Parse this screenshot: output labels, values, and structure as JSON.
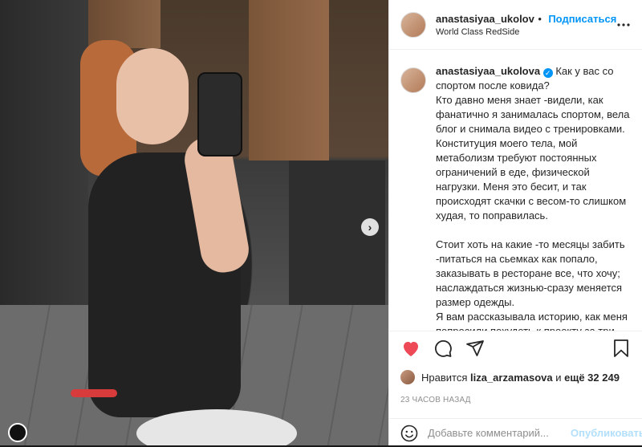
{
  "header": {
    "username": "anastasiyaa_ukolov",
    "follow_label": "Подписаться",
    "separator": "•",
    "location": "World Class RedSide",
    "more_icon": "more-horizontal-icon"
  },
  "caption": {
    "username": "anastasiyaa_ukolova",
    "text": "Как у вас со спортом после ковида?\nКто давно меня знает -видели, как фанатично я занималась спортом, вела блог и снимала видео с тренировками. Конституция моего тела, мой метаболизм требуют постоянных ограничений в еде, физической нагрузки. Меня это бесит, и так происходят скачки с весом-то слишком худая, то поправилась.\n\nСтоит хоть на какие -то месяцы забить -питаться на сьемках как попало, заказывать в ресторане все, что хочу; наслаждаться жизнью-сразу меняется размер одежды.\nЯ вам рассказывала историю, как меня попросили похудеть к проекту за три"
  },
  "actions": {
    "like_icon": "heart-filled-icon",
    "comment_icon": "comment-icon",
    "share_icon": "share-icon",
    "save_icon": "bookmark-icon",
    "like_color": "#ed4956"
  },
  "likes": {
    "prefix": "Нравится",
    "user": "liza_arzamasova",
    "conj": "и",
    "others": "ещё 32 249"
  },
  "timestamp": "23 ЧАСОВ НАЗАД",
  "comment": {
    "placeholder": "Добавьте комментарий...",
    "publish_label": "Опубликовать"
  },
  "carousel": {
    "next_icon": "chevron-right-icon",
    "next_glyph": "›"
  },
  "colors": {
    "accent": "#0095f6",
    "text": "#262626",
    "muted": "#8e8e8e"
  }
}
